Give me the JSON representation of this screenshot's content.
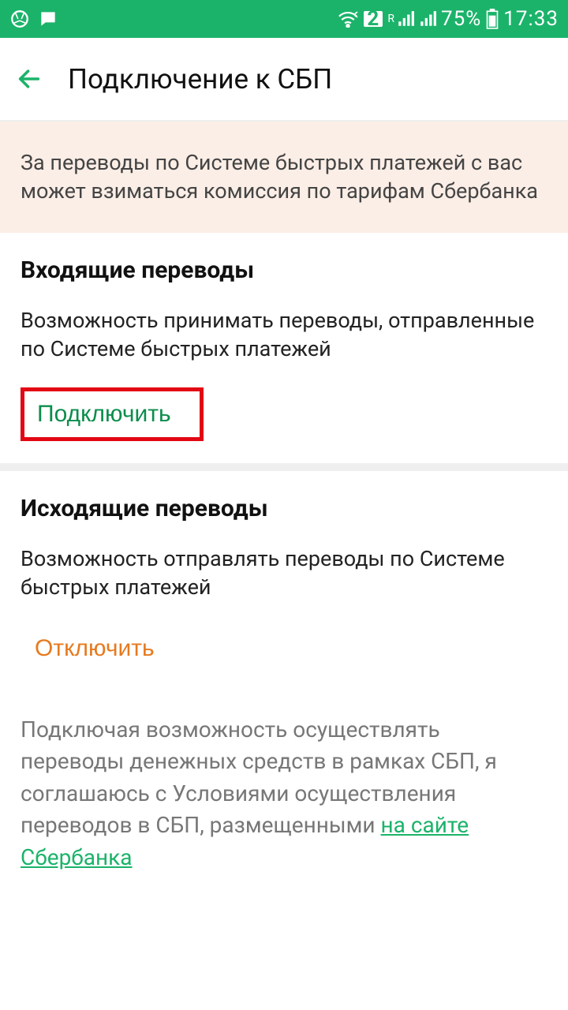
{
  "status": {
    "sim": "2",
    "net_label": "R",
    "battery": "75%",
    "time": "17:33"
  },
  "header": {
    "title": "Подключение к СБП"
  },
  "notice": "За переводы по Системе быстрых платежей с вас может взиматься комиссия по тарифам Сбербанка",
  "incoming": {
    "title": "Входящие переводы",
    "desc": "Возможность принимать переводы, отправленные по Системе быстрых платежей",
    "action": "Подключить"
  },
  "outgoing": {
    "title": "Исходящие переводы",
    "desc": "Возможность отправлять переводы по Системе быстрых платежей",
    "action": "Отключить"
  },
  "agreement": {
    "text": "Подключая возможность осуществлять переводы денежных средств в рамках СБП, я соглашаюсь с Условиями осуществления переводов в СБП, размещенными ",
    "link": "на сайте Сбербанка"
  }
}
